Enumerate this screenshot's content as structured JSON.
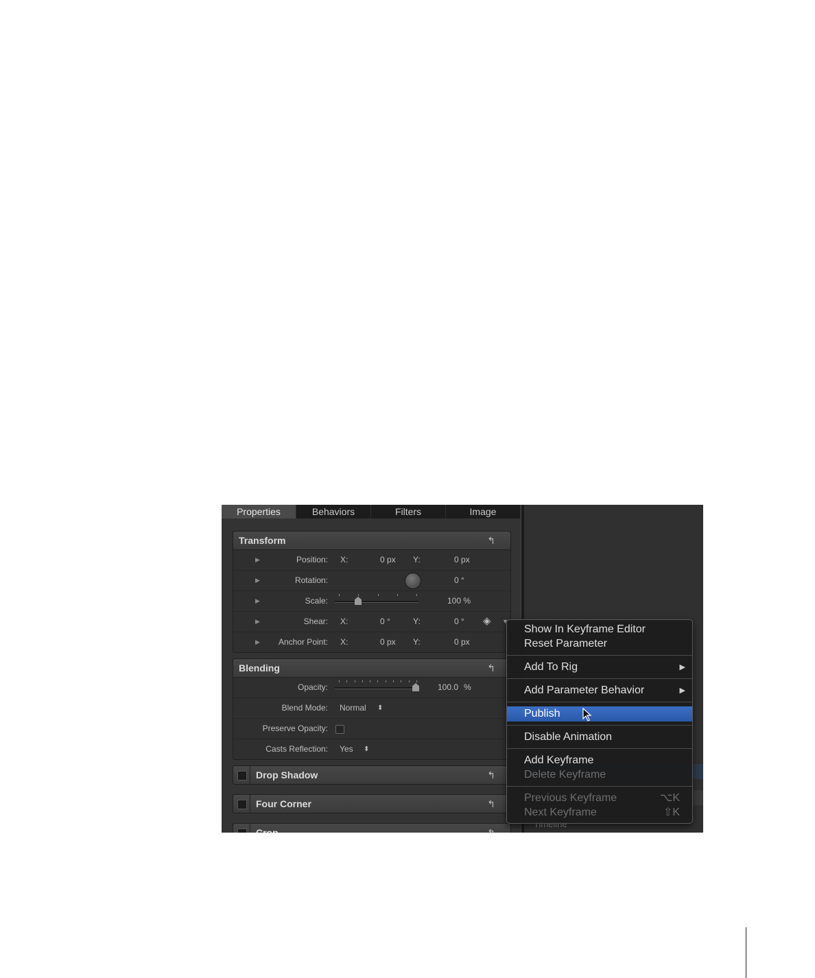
{
  "tabs": [
    "Properties",
    "Behaviors",
    "Filters",
    "Image"
  ],
  "reset_symbol": "↰",
  "transform": {
    "title": "Transform",
    "position": {
      "label": "Position:",
      "x_label": "X:",
      "x_value": "0 px",
      "y_label": "Y:",
      "y_value": "0 px"
    },
    "rotation": {
      "label": "Rotation:",
      "value": "0 °"
    },
    "scale": {
      "label": "Scale:",
      "value": "100 %"
    },
    "shear": {
      "label": "Shear:",
      "x_label": "X:",
      "x_value": "0 °",
      "y_label": "Y:",
      "y_value": "0 °"
    },
    "anchor": {
      "label": "Anchor Point:",
      "x_label": "X:",
      "x_value": "0 px",
      "y_label": "Y:",
      "y_value": "0 px"
    }
  },
  "blending": {
    "title": "Blending",
    "opacity": {
      "label": "Opacity:",
      "value": "100.0",
      "unit": "%"
    },
    "blend_mode": {
      "label": "Blend Mode:",
      "value": "Normal"
    },
    "preserve_opacity": {
      "label": "Preserve Opacity:"
    },
    "casts_reflection": {
      "label": "Casts Reflection:",
      "value": "Yes"
    }
  },
  "collapsed_sections": [
    "Drop Shadow",
    "Four Corner",
    "Crop"
  ],
  "background_label": "Timeline",
  "context_menu": {
    "items": [
      {
        "label": "Show In Keyframe Editor"
      },
      {
        "label": "Reset Parameter"
      },
      {
        "label": "Add To Rig",
        "submenu": "▶"
      },
      {
        "label": "Add Parameter Behavior",
        "submenu": "▶"
      },
      {
        "label": "Publish"
      },
      {
        "label": "Disable Animation"
      },
      {
        "label": "Add Keyframe"
      },
      {
        "label": "Delete Keyframe"
      },
      {
        "label": "Previous Keyframe",
        "shortcut": "⌥K"
      },
      {
        "label": "Next Keyframe",
        "shortcut": "⇧K"
      }
    ]
  },
  "colors": {
    "highlight": "#2f62b8",
    "panel": "#333333",
    "menu": "#1c1c1c"
  }
}
